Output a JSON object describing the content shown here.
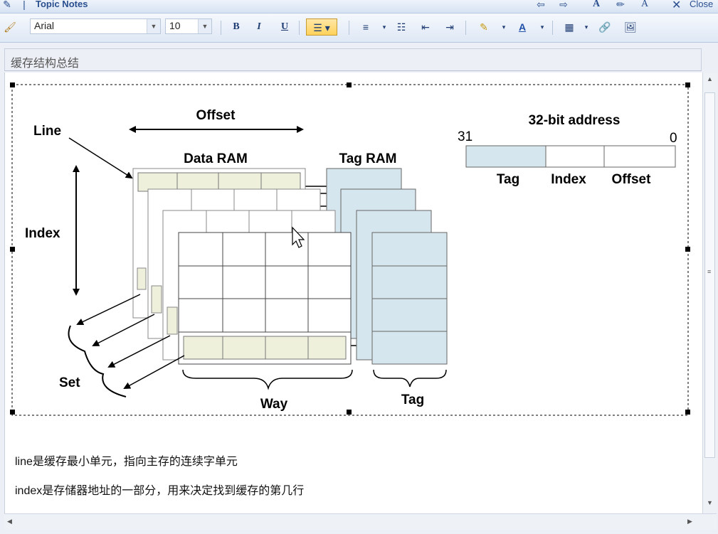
{
  "window": {
    "title": "Topic Notes",
    "close_label": "Close"
  },
  "toolbar": {
    "font_name": "Arial",
    "font_size": "10",
    "bold_label": "B",
    "italic_label": "I",
    "underline_label": "U"
  },
  "topic": {
    "title": "缓存结构总结"
  },
  "diagram": {
    "offset_label": "Offset",
    "line_label": "Line",
    "data_ram_label": "Data RAM",
    "tag_ram_label": "Tag RAM",
    "index_label": "Index",
    "set_label": "Set",
    "way_label": "Way",
    "tag_label": "Tag",
    "address_title": "32-bit address",
    "address_hi_bit": "31",
    "address_lo_bit": "0",
    "address_fields": [
      "Tag",
      "Index",
      "Offset"
    ]
  },
  "notes": [
    "line是缓存最小单元，指向主存的连续字单元",
    "index是存储器地址的一部分，用来决定找到缓存的第几行"
  ],
  "colors": {
    "tag_fill": "#d6e6ef",
    "line_fill": "#eef0dc",
    "toolbar_bg": "#dfe8f5",
    "title_text": "#2a4f8f"
  }
}
